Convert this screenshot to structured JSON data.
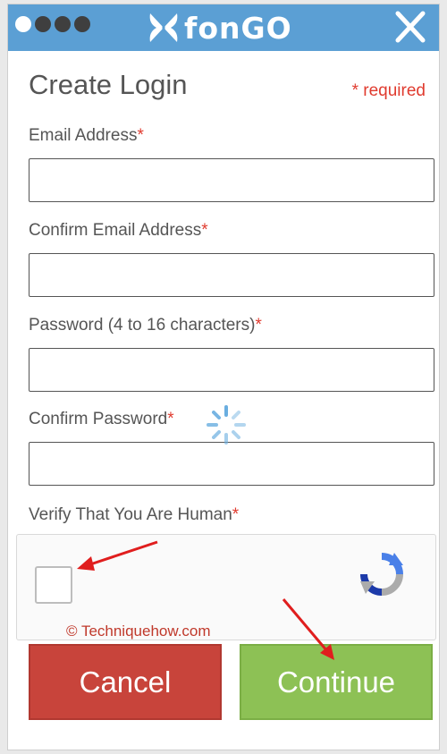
{
  "header": {
    "brand": "fonGO",
    "close_icon": "close-icon",
    "status_dots": [
      "dot-white",
      "dot-dark",
      "dot-dark",
      "dot-dark"
    ],
    "color": "#5b9fd4"
  },
  "form": {
    "title": "Create Login",
    "required_note": "* required",
    "fields": [
      {
        "label": "Email Address",
        "value": "",
        "placeholder": ""
      },
      {
        "label": "Confirm Email Address",
        "value": "",
        "placeholder": ""
      },
      {
        "label": "Password (4 to 16 characters)",
        "value": "",
        "placeholder": ""
      },
      {
        "label": "Confirm Password",
        "value": "",
        "placeholder": ""
      }
    ],
    "required_marker": "*",
    "loading_icon": "spinner-icon"
  },
  "captcha": {
    "label": "Verify That You Are Human",
    "checked": false,
    "icon": "recaptcha-icon"
  },
  "watermark": "© Techniquehow.com",
  "buttons": {
    "cancel": "Cancel",
    "continue": "Continue"
  },
  "colors": {
    "accent": "#5b9fd4",
    "required": "#e03b2f",
    "cancel": "#c8443b",
    "continue": "#8dc155",
    "annotation_arrow": "#e01e1e"
  }
}
